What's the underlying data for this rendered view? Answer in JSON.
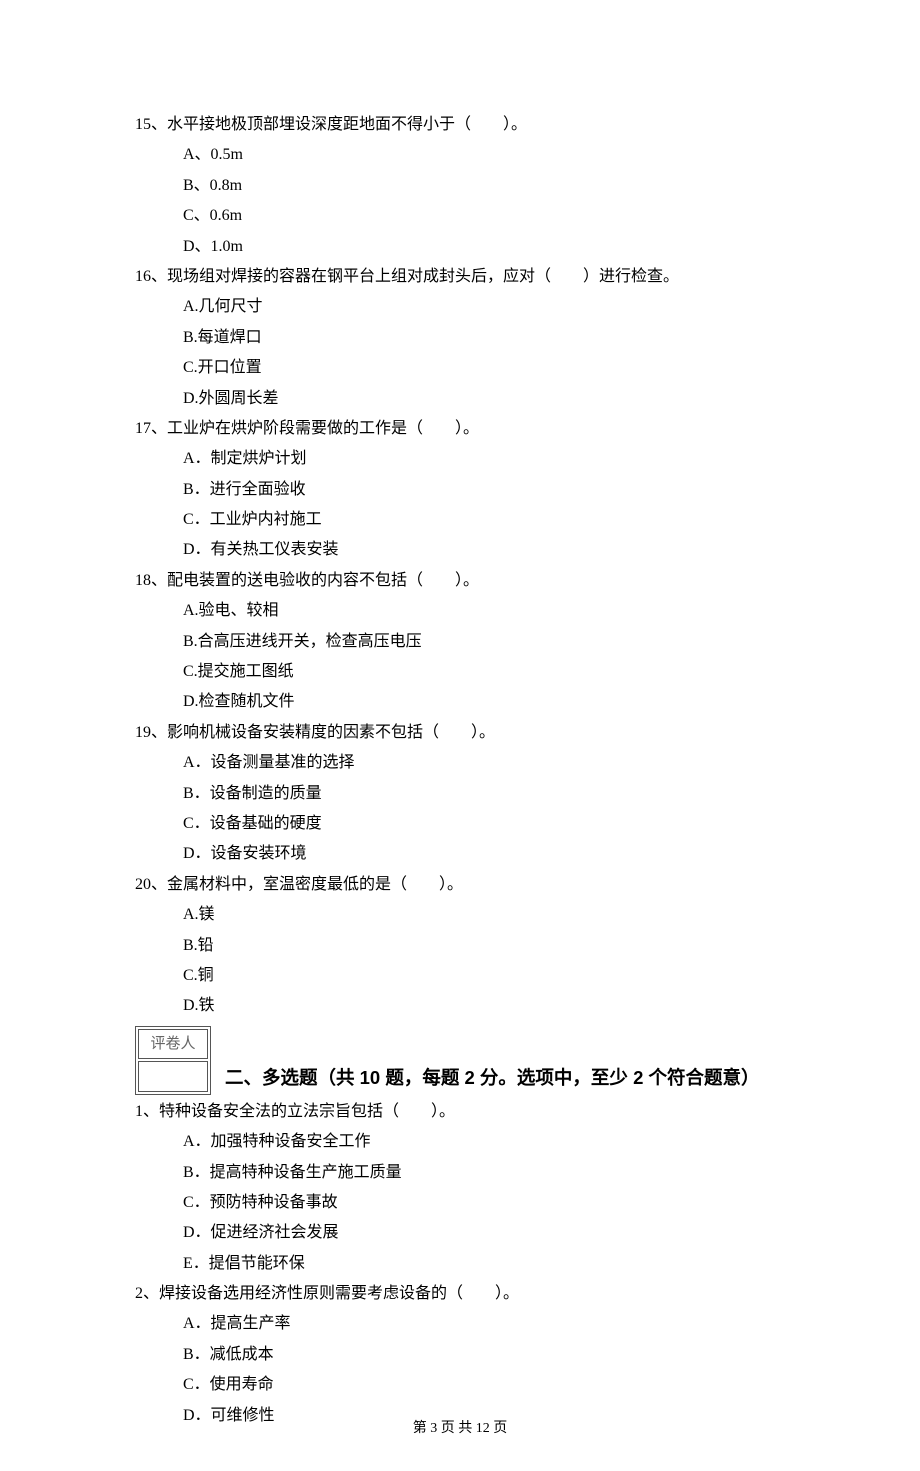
{
  "questions_single": [
    {
      "num": "15、",
      "stem": "水平接地极顶部埋设深度距地面不得小于（　　）。",
      "options": [
        "A、0.5m",
        "B、0.8m",
        "C、0.6m",
        "D、1.0m"
      ]
    },
    {
      "num": "16、",
      "stem": "现场组对焊接的容器在钢平台上组对成封头后，应对（　　）进行检查。",
      "options": [
        "A.几何尺寸",
        "B.每道焊口",
        "C.开口位置",
        "D.外圆周长差"
      ]
    },
    {
      "num": "17、",
      "stem": "工业炉在烘炉阶段需要做的工作是（　　）。",
      "options": [
        "A．制定烘炉计划",
        "B．进行全面验收",
        "C．工业炉内衬施工",
        "D．有关热工仪表安装"
      ]
    },
    {
      "num": "18、",
      "stem": "配电装置的送电验收的内容不包括（　　）。",
      "options": [
        "A.验电、较相",
        "B.合高压进线开关，检查高压电压",
        "C.提交施工图纸",
        "D.检查随机文件"
      ]
    },
    {
      "num": "19、",
      "stem": "影响机械设备安装精度的因素不包括（　　）。",
      "options": [
        "A．设备测量基准的选择",
        "B．设备制造的质量",
        "C．设备基础的硬度",
        "D．设备安装环境"
      ]
    },
    {
      "num": "20、",
      "stem": "金属材料中，室温密度最低的是（　　）。",
      "options": [
        "A.镁",
        "B.铅",
        "C.铜",
        "D.铁"
      ]
    }
  ],
  "grader_label": "评卷人",
  "section2_title": "二、多选题（共 10 题，每题 2 分。选项中，至少 2 个符合题意）",
  "questions_multi": [
    {
      "num": "1、",
      "stem": "特种设备安全法的立法宗旨包括（　　）。",
      "options": [
        "A．加强特种设备安全工作",
        "B．提高特种设备生产施工质量",
        "C．预防特种设备事故",
        "D．促进经济社会发展",
        "E．提倡节能环保"
      ]
    },
    {
      "num": "2、",
      "stem": "焊接设备选用经济性原则需要考虑设备的（　　）。",
      "options": [
        "A．提高生产率",
        "B．减低成本",
        "C．使用寿命",
        "D．可维修性"
      ]
    }
  ],
  "footer": "第 3 页 共 12 页"
}
